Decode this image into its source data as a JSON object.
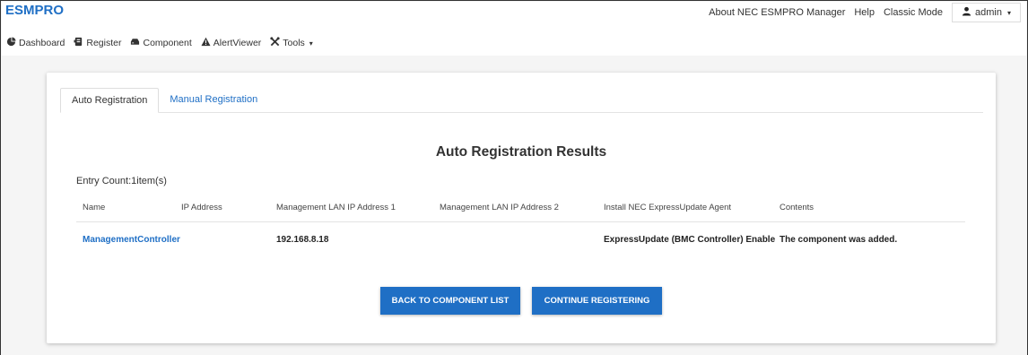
{
  "app": {
    "brand": "ESMPRO"
  },
  "top_links": [
    "About NEC ESMPRO Manager",
    "Help",
    "Classic Mode"
  ],
  "user": {
    "name": "admin",
    "caret": "▾"
  },
  "nav": [
    {
      "label": "Dashboard",
      "icon": "dashboard-icon"
    },
    {
      "label": "Register",
      "icon": "register-icon"
    },
    {
      "label": "Component",
      "icon": "component-icon"
    },
    {
      "label": "AlertViewer",
      "icon": "alert-icon"
    },
    {
      "label": "Tools",
      "icon": "tools-icon",
      "caret": "▾"
    }
  ],
  "tabs": [
    {
      "label": "Auto Registration",
      "active": true
    },
    {
      "label": "Manual Registration",
      "active": false
    }
  ],
  "results": {
    "title": "Auto Registration Results",
    "entry_count": "Entry Count:1item(s)",
    "columns": [
      "Name",
      "IP Address",
      "Management LAN IP Address 1",
      "Management LAN IP Address 2",
      "Install NEC ExpressUpdate Agent",
      "Contents"
    ],
    "rows": [
      [
        "ManagementController",
        "",
        "192.168.8.18",
        "",
        "ExpressUpdate (BMC Controller) Enable",
        "The component was added."
      ]
    ]
  },
  "buttons": {
    "back": "BACK TO COMPONENT LIST",
    "continue": "CONTINUE REGISTERING"
  },
  "colors": {
    "accent": "#1f6fc5",
    "background": "#f5f5f5"
  }
}
